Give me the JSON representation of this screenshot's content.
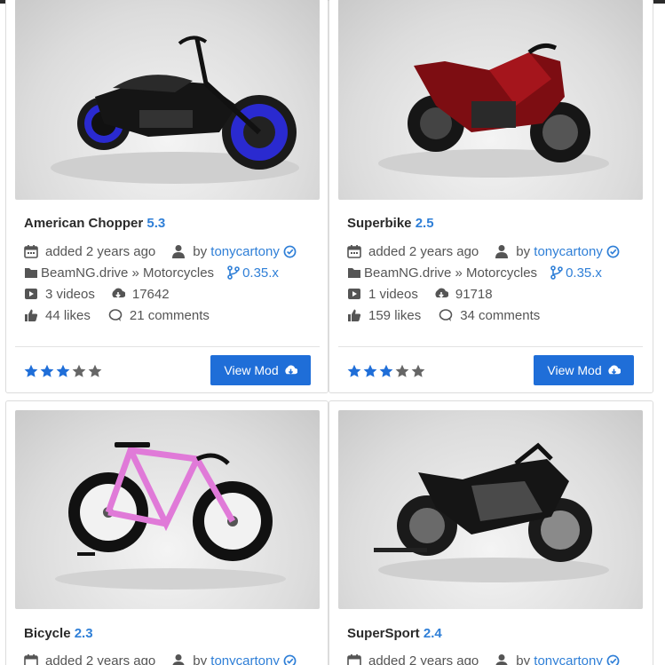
{
  "colors": {
    "accent": "#2f7fd7",
    "button": "#1f6ed8",
    "star_filled": "#1f6ed8",
    "star_empty": "#666666"
  },
  "mods": [
    {
      "title": "American Chopper",
      "version": "5.3",
      "added": "added 2 years ago",
      "by": "by",
      "author": "tonycartony",
      "category": "BeamNG.drive » Motorcycles",
      "game_version": "0.35.x",
      "videos": "3 videos",
      "downloads": "17642",
      "likes": "44 likes",
      "comments": "21 comments",
      "rating": 3,
      "button": "View Mod"
    },
    {
      "title": "Superbike",
      "version": "2.5",
      "added": "added 2 years ago",
      "by": "by",
      "author": "tonycartony",
      "category": "BeamNG.drive » Motorcycles",
      "game_version": "0.35.x",
      "videos": "1 videos",
      "downloads": "91718",
      "likes": "159 likes",
      "comments": "34 comments",
      "rating": 3,
      "button": "View Mod"
    },
    {
      "title": "Bicycle",
      "version": "2.3",
      "added": "added 2 years ago",
      "by": "by",
      "author": "tonycartony"
    },
    {
      "title": "SuperSport",
      "version": "2.4",
      "added": "added 2 years ago",
      "by": "by",
      "author": "tonycartony"
    }
  ]
}
